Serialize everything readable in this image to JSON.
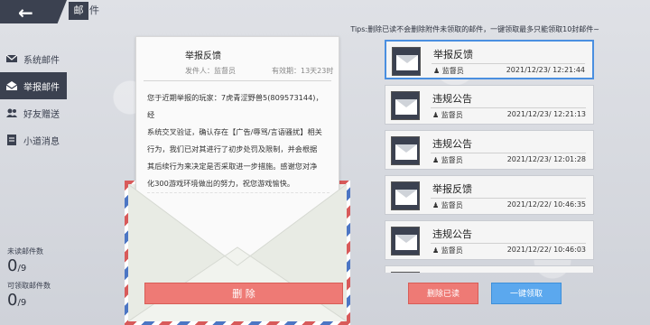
{
  "header": {
    "back_glyph": "←",
    "title_first": "邮",
    "title_rest": "件"
  },
  "sidebar": {
    "items": [
      {
        "label": "系统邮件",
        "icon": "envelope-icon"
      },
      {
        "label": "举报邮件",
        "icon": "open-envelope-icon"
      },
      {
        "label": "好友赠送",
        "icon": "users-icon"
      },
      {
        "label": "小道消息",
        "icon": "document-icon"
      }
    ],
    "active_index": 1
  },
  "stats": {
    "unread_label": "未读邮件数",
    "unread_value": "0",
    "unread_total": "/9",
    "claimable_label": "可领取邮件数",
    "claimable_value": "0",
    "claimable_total": "/9"
  },
  "tips": "Tips:删除已读不会删除附件未领取的邮件，一键领取最多只能领取10封邮件~",
  "letter": {
    "title": "举报反馈",
    "sender_label": "发件人：监督员",
    "expiry_label": "有效期：13天23时",
    "body": [
      "您于近期举报的玩家：7虎青涩野兽5(809573144)，经",
      "系统交叉验证，确认存在【广告/辱骂/言语骚扰】相关",
      "行为，我们已对其进行了初步处罚及限制，并会根据",
      "其后续行为来决定是否采取进一步措施。感谢您对净",
      "化300游戏环境做出的努力，祝您游戏愉快。"
    ],
    "delete_label": "删 除"
  },
  "mail_list": [
    {
      "title": "举报反馈",
      "sender": "监督员",
      "time": "2021/12/23/  12:21:44"
    },
    {
      "title": "违规公告",
      "sender": "监督员",
      "time": "2021/12/23/  12:21:13"
    },
    {
      "title": "违规公告",
      "sender": "监督员",
      "time": "2021/12/23/  12:01:28"
    },
    {
      "title": "举报反馈",
      "sender": "监督员",
      "time": "2021/12/22/  10:46:35"
    },
    {
      "title": "违规公告",
      "sender": "监督员",
      "time": "2021/12/22/  10:46:03"
    },
    {
      "title": "",
      "sender": "",
      "time": ""
    }
  ],
  "buttons": {
    "delete_read": "删除已读",
    "claim_all": "一键领取"
  },
  "colors": {
    "dark": "#3b4150",
    "accent_red": "#ee7a75",
    "accent_blue": "#5ba8ee",
    "selected_border": "#4a8fe0"
  }
}
